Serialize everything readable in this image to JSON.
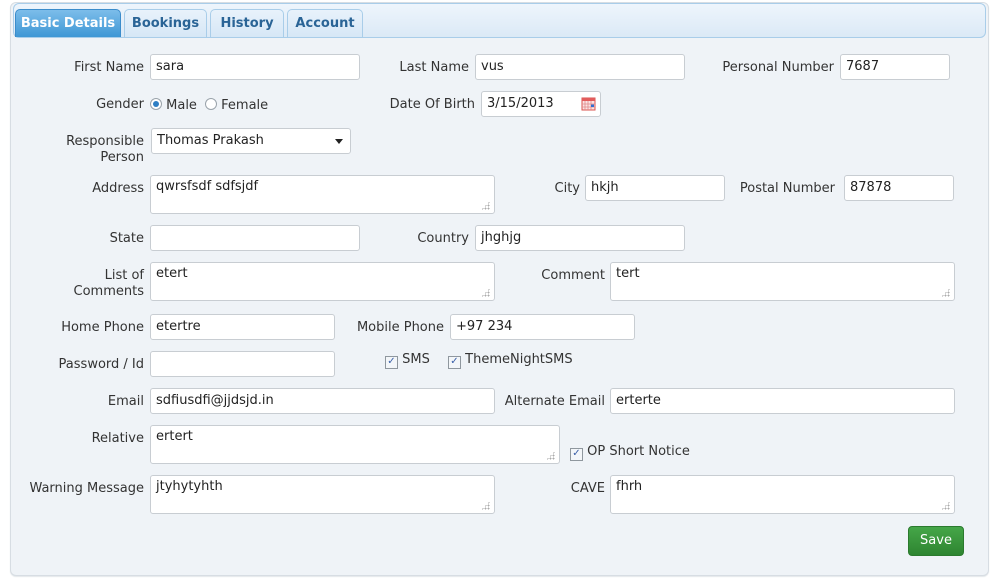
{
  "tabs": [
    {
      "label": "Basic Details",
      "active": true
    },
    {
      "label": "Bookings",
      "active": false
    },
    {
      "label": "History",
      "active": false
    },
    {
      "label": "Account",
      "active": false
    }
  ],
  "form": {
    "first_name": {
      "label": "First Name",
      "value": "sara"
    },
    "last_name": {
      "label": "Last Name",
      "value": "vus"
    },
    "personal_number": {
      "label": "Personal Number",
      "value": "7687"
    },
    "gender": {
      "label": "Gender",
      "options": [
        "Male",
        "Female"
      ],
      "selected": "Male"
    },
    "date_of_birth": {
      "label": "Date Of Birth",
      "value": "3/15/2013",
      "icon": "calendar-icon"
    },
    "responsible_person": {
      "label_line1": "Responsible",
      "label_line2": "Person",
      "value": "Thomas Prakash"
    },
    "address": {
      "label": "Address",
      "value": "qwrsfsdf sdfsjdf"
    },
    "city": {
      "label": "City",
      "value": "hkjh"
    },
    "postal_number": {
      "label": "Postal Number",
      "value": "87878"
    },
    "state": {
      "label": "State",
      "value": ""
    },
    "country": {
      "label": "Country",
      "value": "jhghjg"
    },
    "list_of_comments": {
      "label_line1": "List of",
      "label_line2": "Comments",
      "value": "etert"
    },
    "comment": {
      "label": "Comment",
      "value": "tert"
    },
    "home_phone": {
      "label": "Home Phone",
      "value": "etertre"
    },
    "mobile_phone": {
      "label": "Mobile Phone",
      "value": "+97 234"
    },
    "password_id": {
      "label": "Password / Id",
      "value": ""
    },
    "sms": {
      "label": "SMS",
      "checked": true
    },
    "theme_night_sms": {
      "label": "ThemeNightSMS",
      "checked": true
    },
    "email": {
      "label": "Email",
      "value": "sdfiusdfi@jjdsjd.in"
    },
    "alternate_email": {
      "label": "Alternate Email",
      "value": "erterte"
    },
    "relative": {
      "label": "Relative",
      "value": "ertert"
    },
    "op_short_notice": {
      "label": "OP Short Notice",
      "checked": true
    },
    "warning_message": {
      "label": "Warning Message",
      "value": "jtyhytyhth"
    },
    "cave": {
      "label": "CAVE",
      "value": "fhrh"
    }
  },
  "actions": {
    "save_label": "Save"
  },
  "colors": {
    "active_tab": "#3e97d5",
    "tab_text": "#2a6496",
    "save_button": "#3a9a3d",
    "panel_bg": "#eff3f7"
  }
}
